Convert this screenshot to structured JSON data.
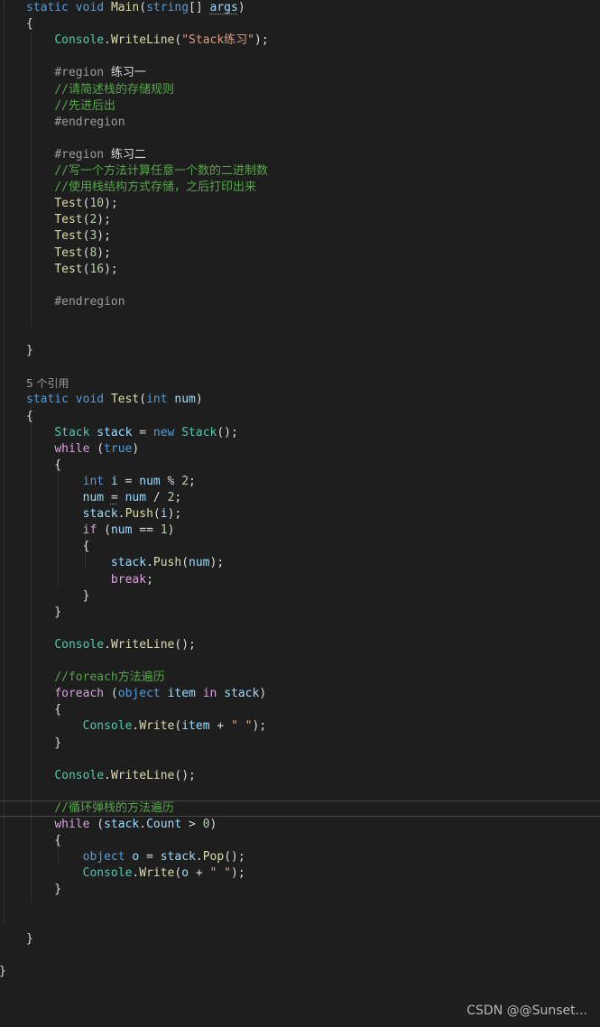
{
  "theme": {
    "background": "#1e1e1e",
    "keyword": "#569cd6",
    "control": "#d8a0df",
    "type": "#4ec9b0",
    "method": "#dcdcaa",
    "variable": "#9cdcfe",
    "string": "#d69d85",
    "number": "#b5cea8",
    "comment": "#57a64a",
    "preprocessor": "#9b9b9b",
    "punctuation": "#dcdcdc"
  },
  "code_lens": {
    "references": "5 个引用"
  },
  "watermark": "CSDN @@Sunset...",
  "code_lines": [
    {
      "tokens": [
        {
          "t": "static",
          "c": "keyword"
        },
        {
          "t": " "
        },
        {
          "t": "void",
          "c": "keyword"
        },
        {
          "t": " "
        },
        {
          "t": "Main",
          "c": "method"
        },
        {
          "t": "("
        },
        {
          "t": "string",
          "c": "keyword"
        },
        {
          "t": "[] "
        },
        {
          "t": "args",
          "c": "variable",
          "sq": true
        },
        {
          "t": ")"
        }
      ]
    },
    {
      "tokens": [
        {
          "t": "{"
        }
      ]
    },
    {
      "tokens": [
        {
          "t": "    "
        },
        {
          "t": "Console",
          "c": "type"
        },
        {
          "t": "."
        },
        {
          "t": "WriteLine",
          "c": "method"
        },
        {
          "t": "("
        },
        {
          "t": "\"Stack练习\"",
          "c": "string"
        },
        {
          "t": ");"
        }
      ]
    },
    {
      "tokens": []
    },
    {
      "tokens": [
        {
          "t": "    "
        },
        {
          "t": "#region",
          "c": "preprocessor"
        },
        {
          "t": " 练习一"
        }
      ]
    },
    {
      "tokens": [
        {
          "t": "    "
        },
        {
          "t": "//请简述栈的存储规则",
          "c": "comment"
        }
      ]
    },
    {
      "tokens": [
        {
          "t": "    "
        },
        {
          "t": "//先进后出",
          "c": "comment"
        }
      ]
    },
    {
      "tokens": [
        {
          "t": "    "
        },
        {
          "t": "#endregion",
          "c": "preprocessor"
        }
      ]
    },
    {
      "tokens": []
    },
    {
      "tokens": [
        {
          "t": "    "
        },
        {
          "t": "#region",
          "c": "preprocessor"
        },
        {
          "t": " 练习二"
        }
      ]
    },
    {
      "tokens": [
        {
          "t": "    "
        },
        {
          "t": "//写一个方法计算任意一个数的二进制数",
          "c": "comment"
        }
      ]
    },
    {
      "tokens": [
        {
          "t": "    "
        },
        {
          "t": "//使用栈结构方式存储，之后打印出来",
          "c": "comment"
        }
      ]
    },
    {
      "tokens": [
        {
          "t": "    "
        },
        {
          "t": "Test",
          "c": "method"
        },
        {
          "t": "("
        },
        {
          "t": "10",
          "c": "number"
        },
        {
          "t": ");"
        }
      ]
    },
    {
      "tokens": [
        {
          "t": "    "
        },
        {
          "t": "Test",
          "c": "method"
        },
        {
          "t": "("
        },
        {
          "t": "2",
          "c": "number"
        },
        {
          "t": ");"
        }
      ]
    },
    {
      "tokens": [
        {
          "t": "    "
        },
        {
          "t": "Test",
          "c": "method"
        },
        {
          "t": "("
        },
        {
          "t": "3",
          "c": "number"
        },
        {
          "t": ");"
        }
      ]
    },
    {
      "tokens": [
        {
          "t": "    "
        },
        {
          "t": "Test",
          "c": "method"
        },
        {
          "t": "("
        },
        {
          "t": "8",
          "c": "number"
        },
        {
          "t": ");"
        }
      ]
    },
    {
      "tokens": [
        {
          "t": "    "
        },
        {
          "t": "Test",
          "c": "method"
        },
        {
          "t": "("
        },
        {
          "t": "16",
          "c": "number"
        },
        {
          "t": ");"
        }
      ]
    },
    {
      "tokens": []
    },
    {
      "tokens": [
        {
          "t": "    "
        },
        {
          "t": "#endregion",
          "c": "preprocessor"
        }
      ]
    },
    {
      "tokens": []
    },
    {
      "tokens": []
    },
    {
      "tokens": [
        {
          "t": "}"
        }
      ]
    },
    {
      "tokens": []
    },
    {
      "lens": true,
      "tokens": []
    },
    {
      "tokens": [
        {
          "t": "static",
          "c": "keyword"
        },
        {
          "t": " "
        },
        {
          "t": "void",
          "c": "keyword"
        },
        {
          "t": " "
        },
        {
          "t": "Test",
          "c": "method"
        },
        {
          "t": "("
        },
        {
          "t": "int",
          "c": "keyword"
        },
        {
          "t": " "
        },
        {
          "t": "num",
          "c": "variable"
        },
        {
          "t": ")"
        }
      ]
    },
    {
      "tokens": [
        {
          "t": "{"
        }
      ]
    },
    {
      "tokens": [
        {
          "t": "    "
        },
        {
          "t": "Stack",
          "c": "type"
        },
        {
          "t": " "
        },
        {
          "t": "stack",
          "c": "variable"
        },
        {
          "t": " = "
        },
        {
          "t": "new",
          "c": "keyword"
        },
        {
          "t": " "
        },
        {
          "t": "Stack",
          "c": "type"
        },
        {
          "t": "();"
        }
      ]
    },
    {
      "tokens": [
        {
          "t": "    "
        },
        {
          "t": "while",
          "c": "control"
        },
        {
          "t": " ("
        },
        {
          "t": "true",
          "c": "keyword"
        },
        {
          "t": ")"
        }
      ]
    },
    {
      "tokens": [
        {
          "t": "    {"
        }
      ]
    },
    {
      "tokens": [
        {
          "t": "        "
        },
        {
          "t": "int",
          "c": "keyword"
        },
        {
          "t": " "
        },
        {
          "t": "i",
          "c": "variable"
        },
        {
          "t": " = "
        },
        {
          "t": "num",
          "c": "variable"
        },
        {
          "t": " % "
        },
        {
          "t": "2",
          "c": "number"
        },
        {
          "t": ";"
        }
      ]
    },
    {
      "tokens": [
        {
          "t": "        "
        },
        {
          "t": "num",
          "c": "variable"
        },
        {
          "t": " "
        },
        {
          "t": "=",
          "sq": true
        },
        {
          "t": " "
        },
        {
          "t": "num",
          "c": "variable"
        },
        {
          "t": " / "
        },
        {
          "t": "2",
          "c": "number"
        },
        {
          "t": ";"
        }
      ]
    },
    {
      "tokens": [
        {
          "t": "        "
        },
        {
          "t": "stack",
          "c": "variable"
        },
        {
          "t": "."
        },
        {
          "t": "Push",
          "c": "method"
        },
        {
          "t": "("
        },
        {
          "t": "i",
          "c": "variable"
        },
        {
          "t": ");"
        }
      ]
    },
    {
      "tokens": [
        {
          "t": "        "
        },
        {
          "t": "if",
          "c": "control"
        },
        {
          "t": " ("
        },
        {
          "t": "num",
          "c": "variable"
        },
        {
          "t": " == "
        },
        {
          "t": "1",
          "c": "number"
        },
        {
          "t": ")"
        }
      ]
    },
    {
      "tokens": [
        {
          "t": "        {"
        }
      ]
    },
    {
      "tokens": [
        {
          "t": "            "
        },
        {
          "t": "stack",
          "c": "variable"
        },
        {
          "t": "."
        },
        {
          "t": "Push",
          "c": "method"
        },
        {
          "t": "("
        },
        {
          "t": "num",
          "c": "variable"
        },
        {
          "t": ");"
        }
      ]
    },
    {
      "tokens": [
        {
          "t": "            "
        },
        {
          "t": "break",
          "c": "control"
        },
        {
          "t": ";"
        }
      ]
    },
    {
      "tokens": [
        {
          "t": "        }"
        }
      ]
    },
    {
      "tokens": [
        {
          "t": "    }"
        }
      ]
    },
    {
      "tokens": []
    },
    {
      "tokens": [
        {
          "t": "    "
        },
        {
          "t": "Console",
          "c": "type"
        },
        {
          "t": "."
        },
        {
          "t": "WriteLine",
          "c": "method"
        },
        {
          "t": "();"
        }
      ]
    },
    {
      "tokens": []
    },
    {
      "tokens": [
        {
          "t": "    "
        },
        {
          "t": "//foreach方法遍历",
          "c": "comment"
        }
      ]
    },
    {
      "tokens": [
        {
          "t": "    "
        },
        {
          "t": "foreach",
          "c": "control"
        },
        {
          "t": " ("
        },
        {
          "t": "object",
          "c": "keyword"
        },
        {
          "t": " "
        },
        {
          "t": "item",
          "c": "variable"
        },
        {
          "t": " "
        },
        {
          "t": "in",
          "c": "control"
        },
        {
          "t": " "
        },
        {
          "t": "stack",
          "c": "variable"
        },
        {
          "t": ")"
        }
      ]
    },
    {
      "tokens": [
        {
          "t": "    {"
        }
      ]
    },
    {
      "tokens": [
        {
          "t": "        "
        },
        {
          "t": "Console",
          "c": "type"
        },
        {
          "t": "."
        },
        {
          "t": "Write",
          "c": "method"
        },
        {
          "t": "("
        },
        {
          "t": "item",
          "c": "variable"
        },
        {
          "t": " + "
        },
        {
          "t": "\" \"",
          "c": "string"
        },
        {
          "t": ");"
        }
      ]
    },
    {
      "tokens": [
        {
          "t": "    }"
        }
      ]
    },
    {
      "tokens": []
    },
    {
      "tokens": [
        {
          "t": "    "
        },
        {
          "t": "Console",
          "c": "type"
        },
        {
          "t": "."
        },
        {
          "t": "WriteLine",
          "c": "method"
        },
        {
          "t": "();"
        }
      ]
    },
    {
      "tokens": []
    },
    {
      "hl": true,
      "tokens": [
        {
          "t": "    "
        },
        {
          "t": "//循环弹栈的方法遍历",
          "c": "comment"
        }
      ]
    },
    {
      "tokens": [
        {
          "t": "    "
        },
        {
          "t": "while",
          "c": "control"
        },
        {
          "t": " ("
        },
        {
          "t": "stack",
          "c": "variable"
        },
        {
          "t": "."
        },
        {
          "t": "Count",
          "c": "variable"
        },
        {
          "t": " > "
        },
        {
          "t": "0",
          "c": "number"
        },
        {
          "t": ")"
        }
      ]
    },
    {
      "tokens": [
        {
          "t": "    {"
        }
      ]
    },
    {
      "tokens": [
        {
          "t": "        "
        },
        {
          "t": "object",
          "c": "keyword"
        },
        {
          "t": " "
        },
        {
          "t": "o",
          "c": "variable"
        },
        {
          "t": " = "
        },
        {
          "t": "stack",
          "c": "variable"
        },
        {
          "t": "."
        },
        {
          "t": "Pop",
          "c": "method"
        },
        {
          "t": "();"
        }
      ]
    },
    {
      "tokens": [
        {
          "t": "        "
        },
        {
          "t": "Console",
          "c": "type"
        },
        {
          "t": "."
        },
        {
          "t": "Write",
          "c": "method"
        },
        {
          "t": "("
        },
        {
          "t": "o",
          "c": "variable"
        },
        {
          "t": " + "
        },
        {
          "t": "\" \"",
          "c": "string"
        },
        {
          "t": ");"
        }
      ]
    },
    {
      "tokens": [
        {
          "t": "    }"
        }
      ]
    },
    {
      "tokens": []
    },
    {
      "tokens": []
    },
    {
      "tokens": [
        {
          "t": "}"
        }
      ]
    },
    {
      "tokens": []
    },
    {
      "outer": true,
      "tokens": [
        {
          "t": "}"
        }
      ]
    }
  ]
}
